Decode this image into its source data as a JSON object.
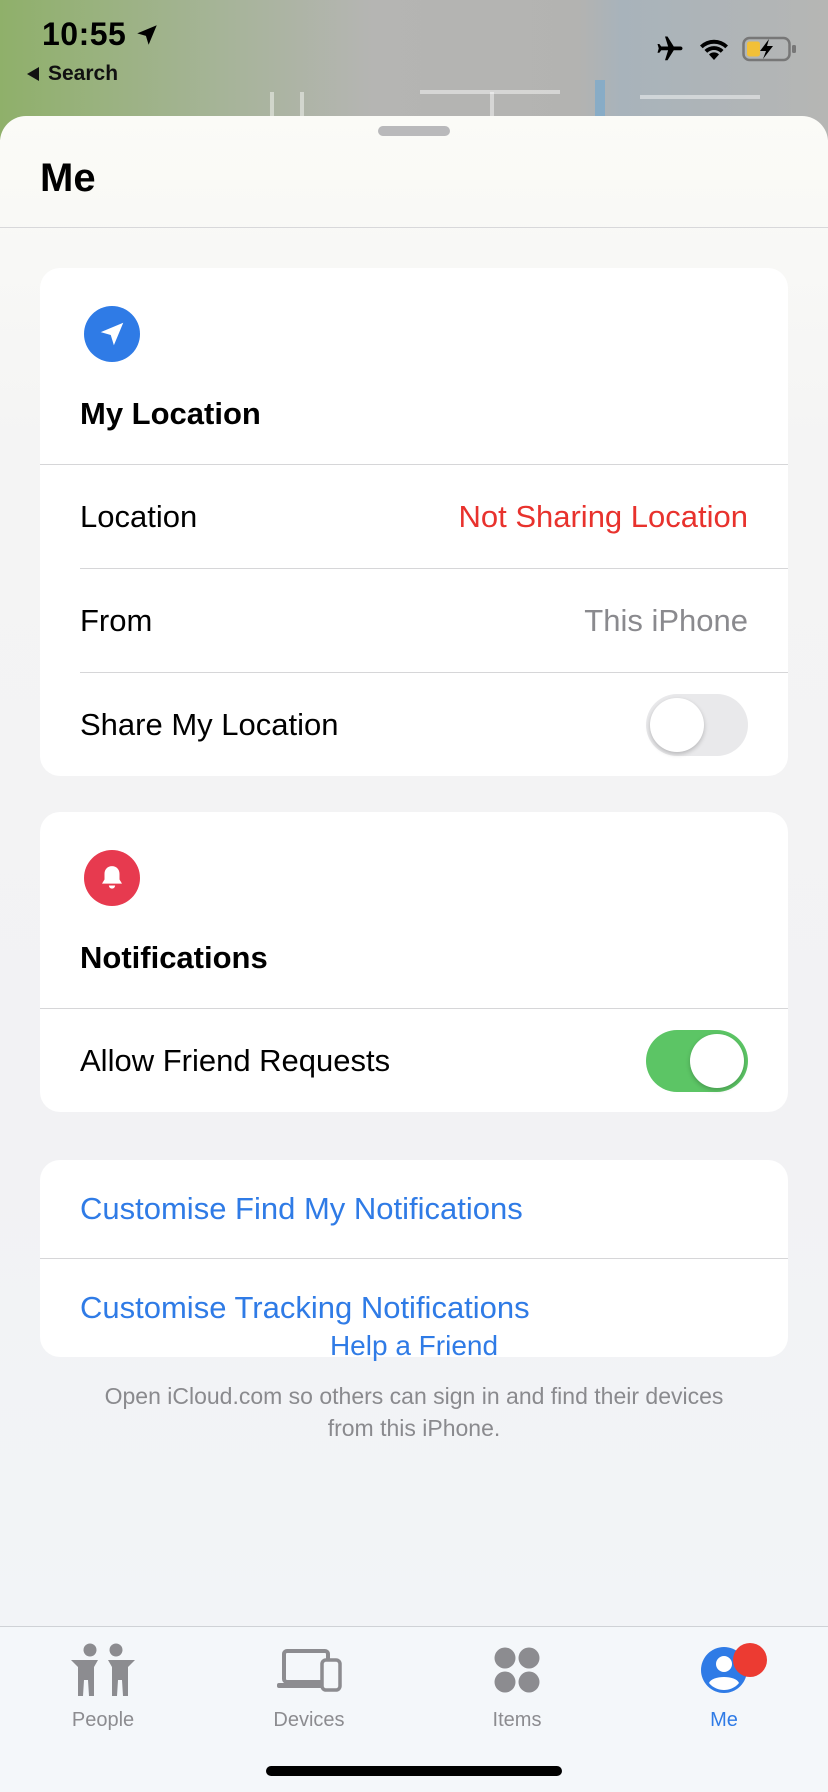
{
  "status_bar": {
    "time": "10:55",
    "back_label": "Search"
  },
  "sheet": {
    "title": "Me"
  },
  "my_location": {
    "icon": "location-arrow-icon",
    "icon_color": "#2f7be6",
    "title": "My Location",
    "rows": [
      {
        "label": "Location",
        "value": "Not Sharing Location",
        "value_color": "#e8322d"
      },
      {
        "label": "From",
        "value": "This iPhone"
      }
    ],
    "share_label": "Share My Location",
    "share_on": false
  },
  "notifications": {
    "icon": "bell-icon",
    "icon_color": "#e73a4f",
    "title": "Notifications",
    "allow_label": "Allow Friend Requests",
    "allow_on": true
  },
  "links": [
    "Customise Find My Notifications",
    "Customise Tracking Notifications"
  ],
  "help": {
    "title": "Help a Friend",
    "text": "Open iCloud.com so others can sign in and find their devices from this iPhone."
  },
  "tabs": [
    {
      "label": "People",
      "icon": "people-icon",
      "active": false
    },
    {
      "label": "Devices",
      "icon": "devices-icon",
      "active": false
    },
    {
      "label": "Items",
      "icon": "items-icon",
      "active": false
    },
    {
      "label": "Me",
      "icon": "me-icon",
      "active": true,
      "badge": true
    }
  ],
  "colors": {
    "accent": "#2f7be6",
    "toggle_on": "#5cc565",
    "alert_red": "#e8322d",
    "badge_red": "#ec3b32"
  }
}
